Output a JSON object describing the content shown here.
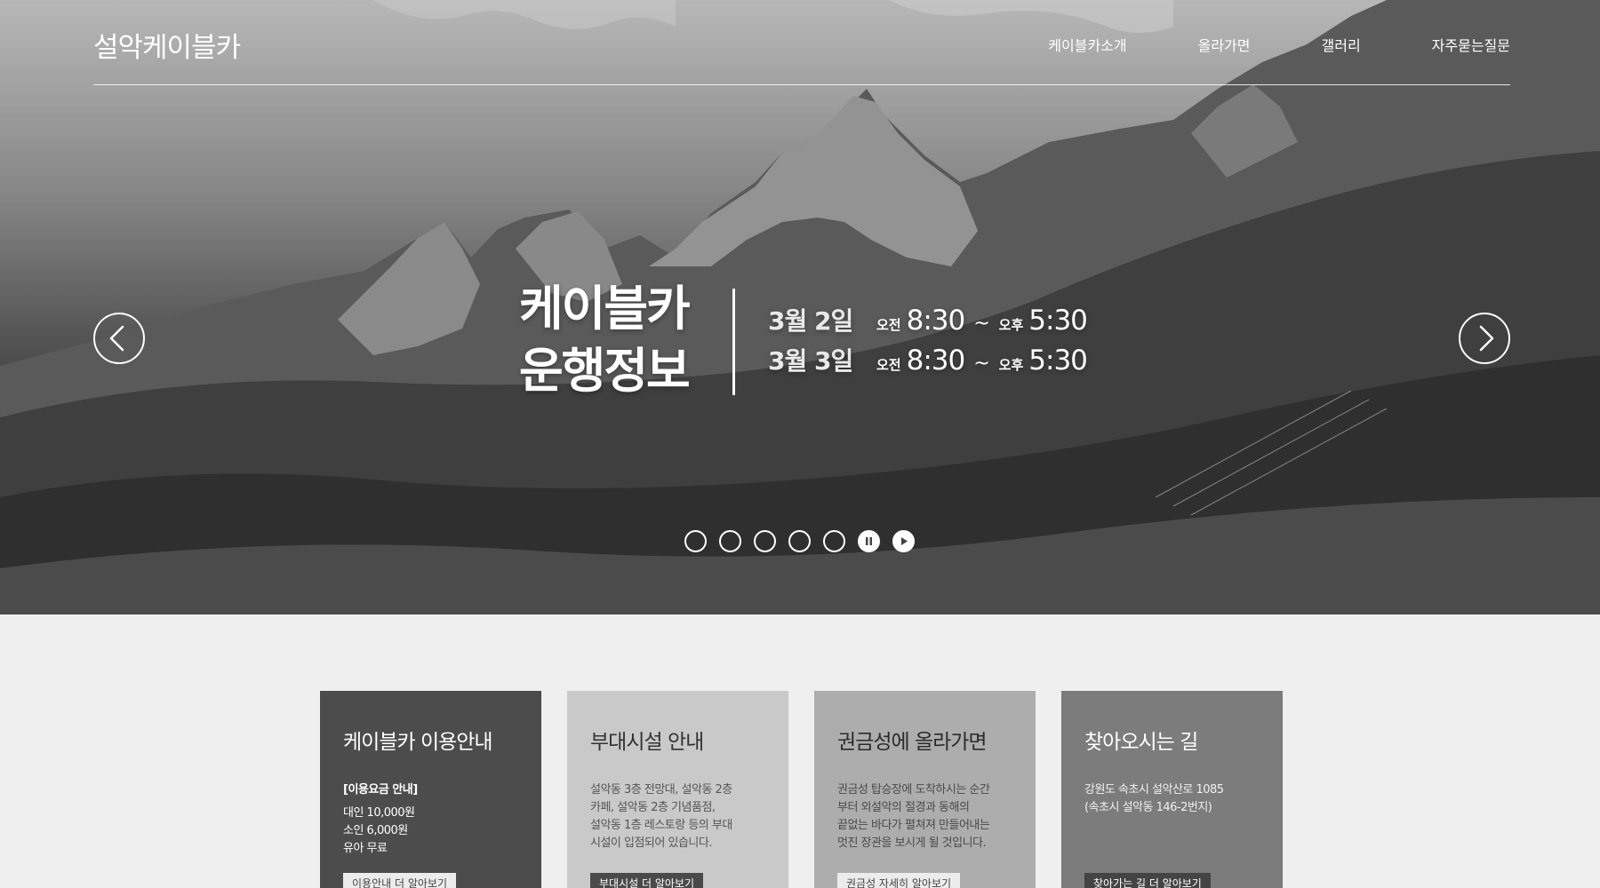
{
  "header": {
    "logo": "설악케이블카",
    "nav": [
      "케이블카소개",
      "올라가면",
      "갤러리",
      "자주묻는질문"
    ]
  },
  "hero": {
    "title_line1": "케이블카",
    "title_line2": "운행정보",
    "schedule": [
      {
        "date": "3월 2일",
        "am_label": "오전",
        "start": "8:30",
        "tilde": "~",
        "pm_label": "오후",
        "end": "5:30"
      },
      {
        "date": "3월 3일",
        "am_label": "오전",
        "start": "8:30",
        "tilde": "~",
        "pm_label": "오후",
        "end": "5:30"
      }
    ],
    "prev_icon": "chevron-left-icon",
    "next_icon": "chevron-right-icon",
    "slides_total": 5,
    "controls": [
      "pause-icon",
      "play-icon"
    ]
  },
  "cards": [
    {
      "title": "케이블카 이용안내",
      "heading": "[이용요금 안내]",
      "lines": [
        "대인 10,000원",
        "소인 6,000원",
        "유아 무료"
      ],
      "more": "이용안내 더 알아보기"
    },
    {
      "title": "부대시설 안내",
      "lines": [
        "설악동 3층 전망대, 설악동 2층",
        "카페, 설악동 2층 기념품점,",
        "설악동 1층 레스토랑 등의 부대",
        "시설이 입점되어 있습니다."
      ],
      "more": "부대시설 더 알아보기"
    },
    {
      "title": "권금성에 올라가면",
      "lines": [
        "권금성 탑승장에 도착하시는 순간",
        "부터 외설악의 절경과 동해의",
        "끝없는 바다가 펼쳐져 만들어내는",
        "멋진 장관을 보시게 될 것입니다."
      ],
      "more": "권금성 자세히 알아보기"
    },
    {
      "title": "찾아오시는 길",
      "lines": [
        "강원도 속초시 설악산로 1085",
        "(속초시 설악동 146-2번지)"
      ],
      "more": "찾아가는 길 더 알아보기"
    }
  ],
  "colors": {
    "page_bg": "#efefef",
    "card_dark": "#4c4c4c",
    "card_light": "#c9c9c9",
    "card_mid": "#adadad",
    "card_gray": "#7c7c7c"
  }
}
